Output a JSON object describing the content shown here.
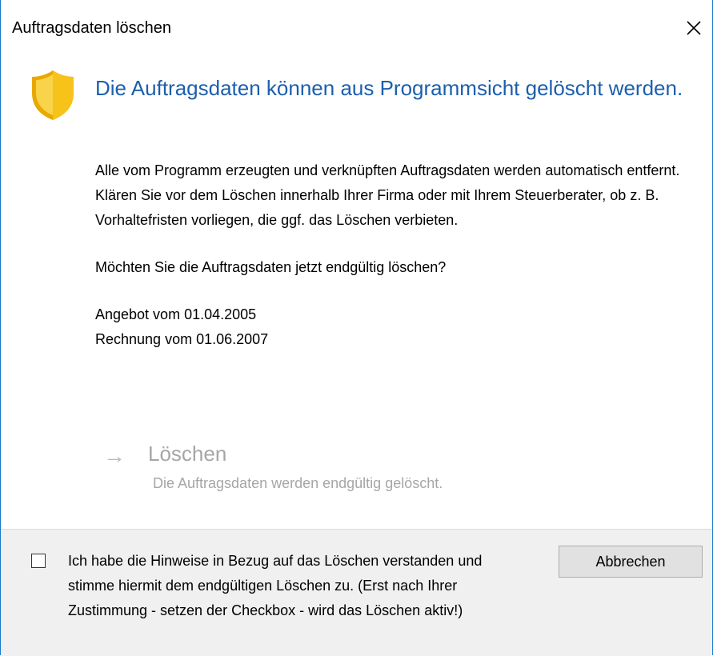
{
  "window": {
    "title": "Auftragsdaten löschen",
    "close_icon": "close-icon"
  },
  "dialog": {
    "icon": "shield-warning-icon",
    "headline": "Die Auftragsdaten können aus Programmsicht gelöscht werden.",
    "body_line1": "Alle vom Programm erzeugten und verknüpften Auftragsdaten werden automatisch entfernt.",
    "body_line2": "Klären Sie vor dem Löschen innerhalb Ihrer Firma oder mit Ihrem Steuerberater, ob z. B. Vorhaltefristen vorliegen, die ggf. das Löschen verbieten.",
    "question": "Möchten Sie die Auftragsdaten jetzt endgültig löschen?",
    "documents": [
      "Angebot vom 01.04.2005",
      "Rechnung vom 01.06.2007"
    ]
  },
  "command_link": {
    "arrow": "→",
    "title": "Löschen",
    "description": "Die Auftragsdaten werden endgültig gelöscht.",
    "enabled": false
  },
  "footer": {
    "checkbox_checked": false,
    "checkbox_label": "Ich habe die Hinweise in Bezug auf das Löschen verstanden und stimme hiermit dem endgültigen Löschen zu. (Erst nach Ihrer Zustimmung - setzen der Checkbox - wird das Löschen aktiv!)",
    "cancel_label": "Abbrechen"
  },
  "colors": {
    "accent_border": "#1979ca",
    "headline": "#1c5fad",
    "disabled_text": "#a6a6a6",
    "footer_bg": "#f0f0f0",
    "shield_yellow": "#f7c21a"
  }
}
